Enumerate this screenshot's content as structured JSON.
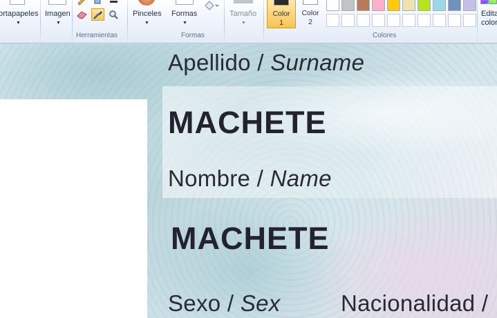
{
  "ribbon": {
    "portapapeles": {
      "label": "ortapapeles"
    },
    "imagen": {
      "label": "Imagen"
    },
    "herramientas": {
      "group_label": "Herramientas",
      "tools": [
        "eraser-icon",
        "color-picker-icon",
        "magnifier-icon"
      ]
    },
    "pinceles": {
      "label": "Pinceles"
    },
    "formas": {
      "label": "Formas",
      "group_label": "Formas"
    },
    "tamano": {
      "label": "Tamaño"
    },
    "color1": {
      "line1": "Color",
      "line2": "1",
      "color": "#2b2b2b"
    },
    "color2": {
      "line1": "Color",
      "line2": "2",
      "color": "#ffffff"
    },
    "colores": {
      "group_label": "Colores",
      "row1": [
        "#ffffff",
        "#c3c3c3",
        "#b97a57",
        "#ffaec9",
        "#ffc90e",
        "#efe4b0",
        "#b5e61d",
        "#99d9ea",
        "#7092be",
        "#c8bfe7"
      ],
      "row2_count": 10
    },
    "editar_colores": {
      "line1": "Edita",
      "line2": "color"
    }
  },
  "document": {
    "surname_label": "Apellido / ",
    "surname_label_en": "Surname",
    "surname_value": "MACHETE",
    "name_label": "Nombre / ",
    "name_label_en": "Name",
    "name_value": "MACHETE",
    "sex_label": "Sexo / ",
    "sex_label_en": "Sex",
    "nationality_label": "Nacionalidad /"
  }
}
